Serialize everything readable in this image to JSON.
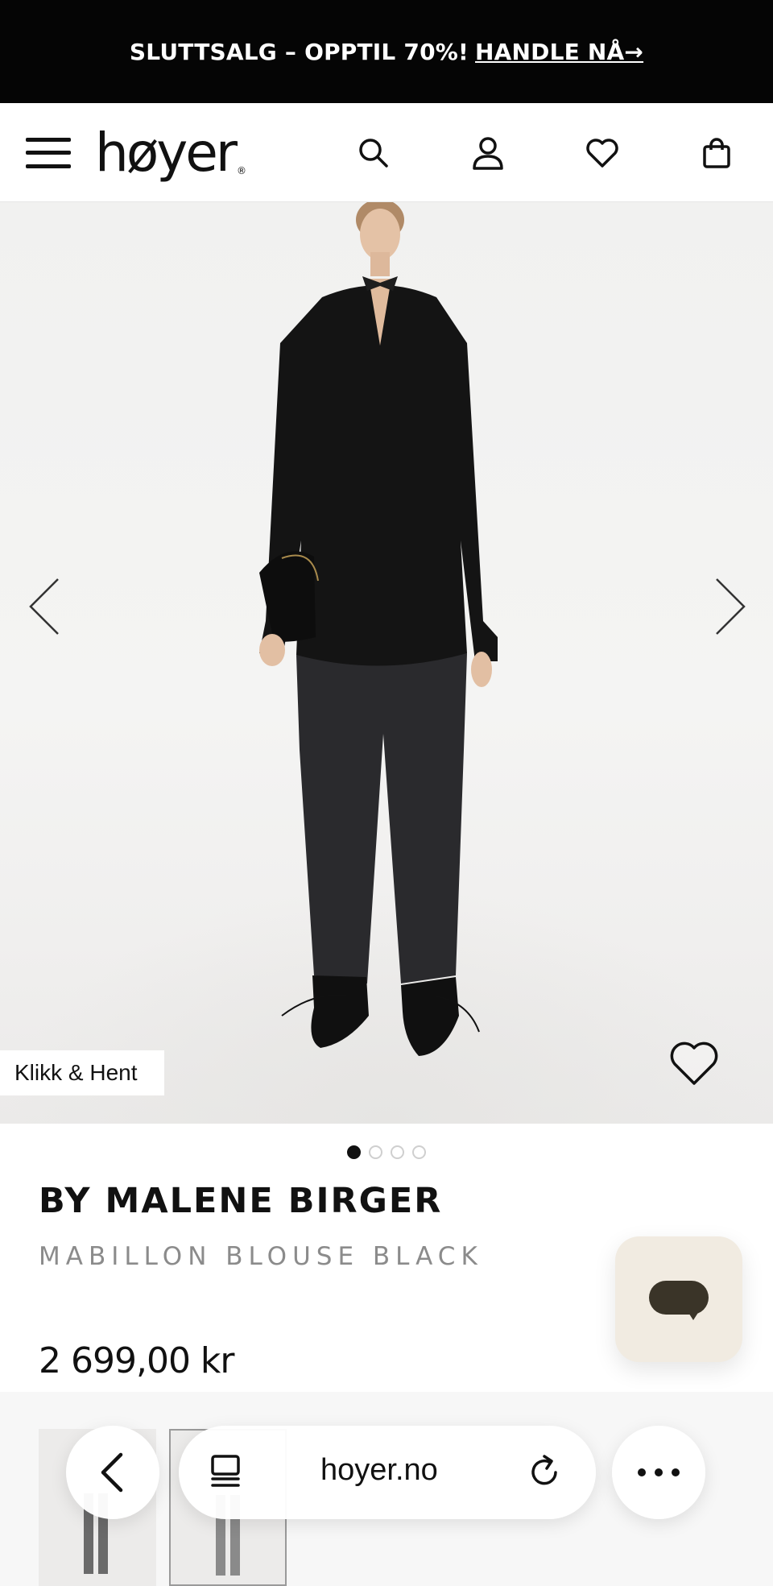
{
  "promo": {
    "text": "SLUTTSALG – OPPTIL 70%!",
    "link": "HANDLE NÅ→"
  },
  "header": {
    "logo": "høyer",
    "logo_mark": "®",
    "icons": [
      "menu-icon",
      "search-icon",
      "user-icon",
      "heart-icon",
      "bag-icon"
    ]
  },
  "hero": {
    "badge": "Klikk & Hent",
    "gallery_index": 1,
    "gallery_count": 4
  },
  "product": {
    "brand": "BY MALENE BIRGER",
    "name": "MABILLON BLOUSE BLACK",
    "price": "2 699,00 kr"
  },
  "browser": {
    "url": "hoyer.no"
  },
  "colors": {
    "promo_bg": "#050505",
    "chat_bg": "#f1ebe1",
    "chat_bubble": "#3a3428",
    "product_name": "#8b8b8b"
  }
}
